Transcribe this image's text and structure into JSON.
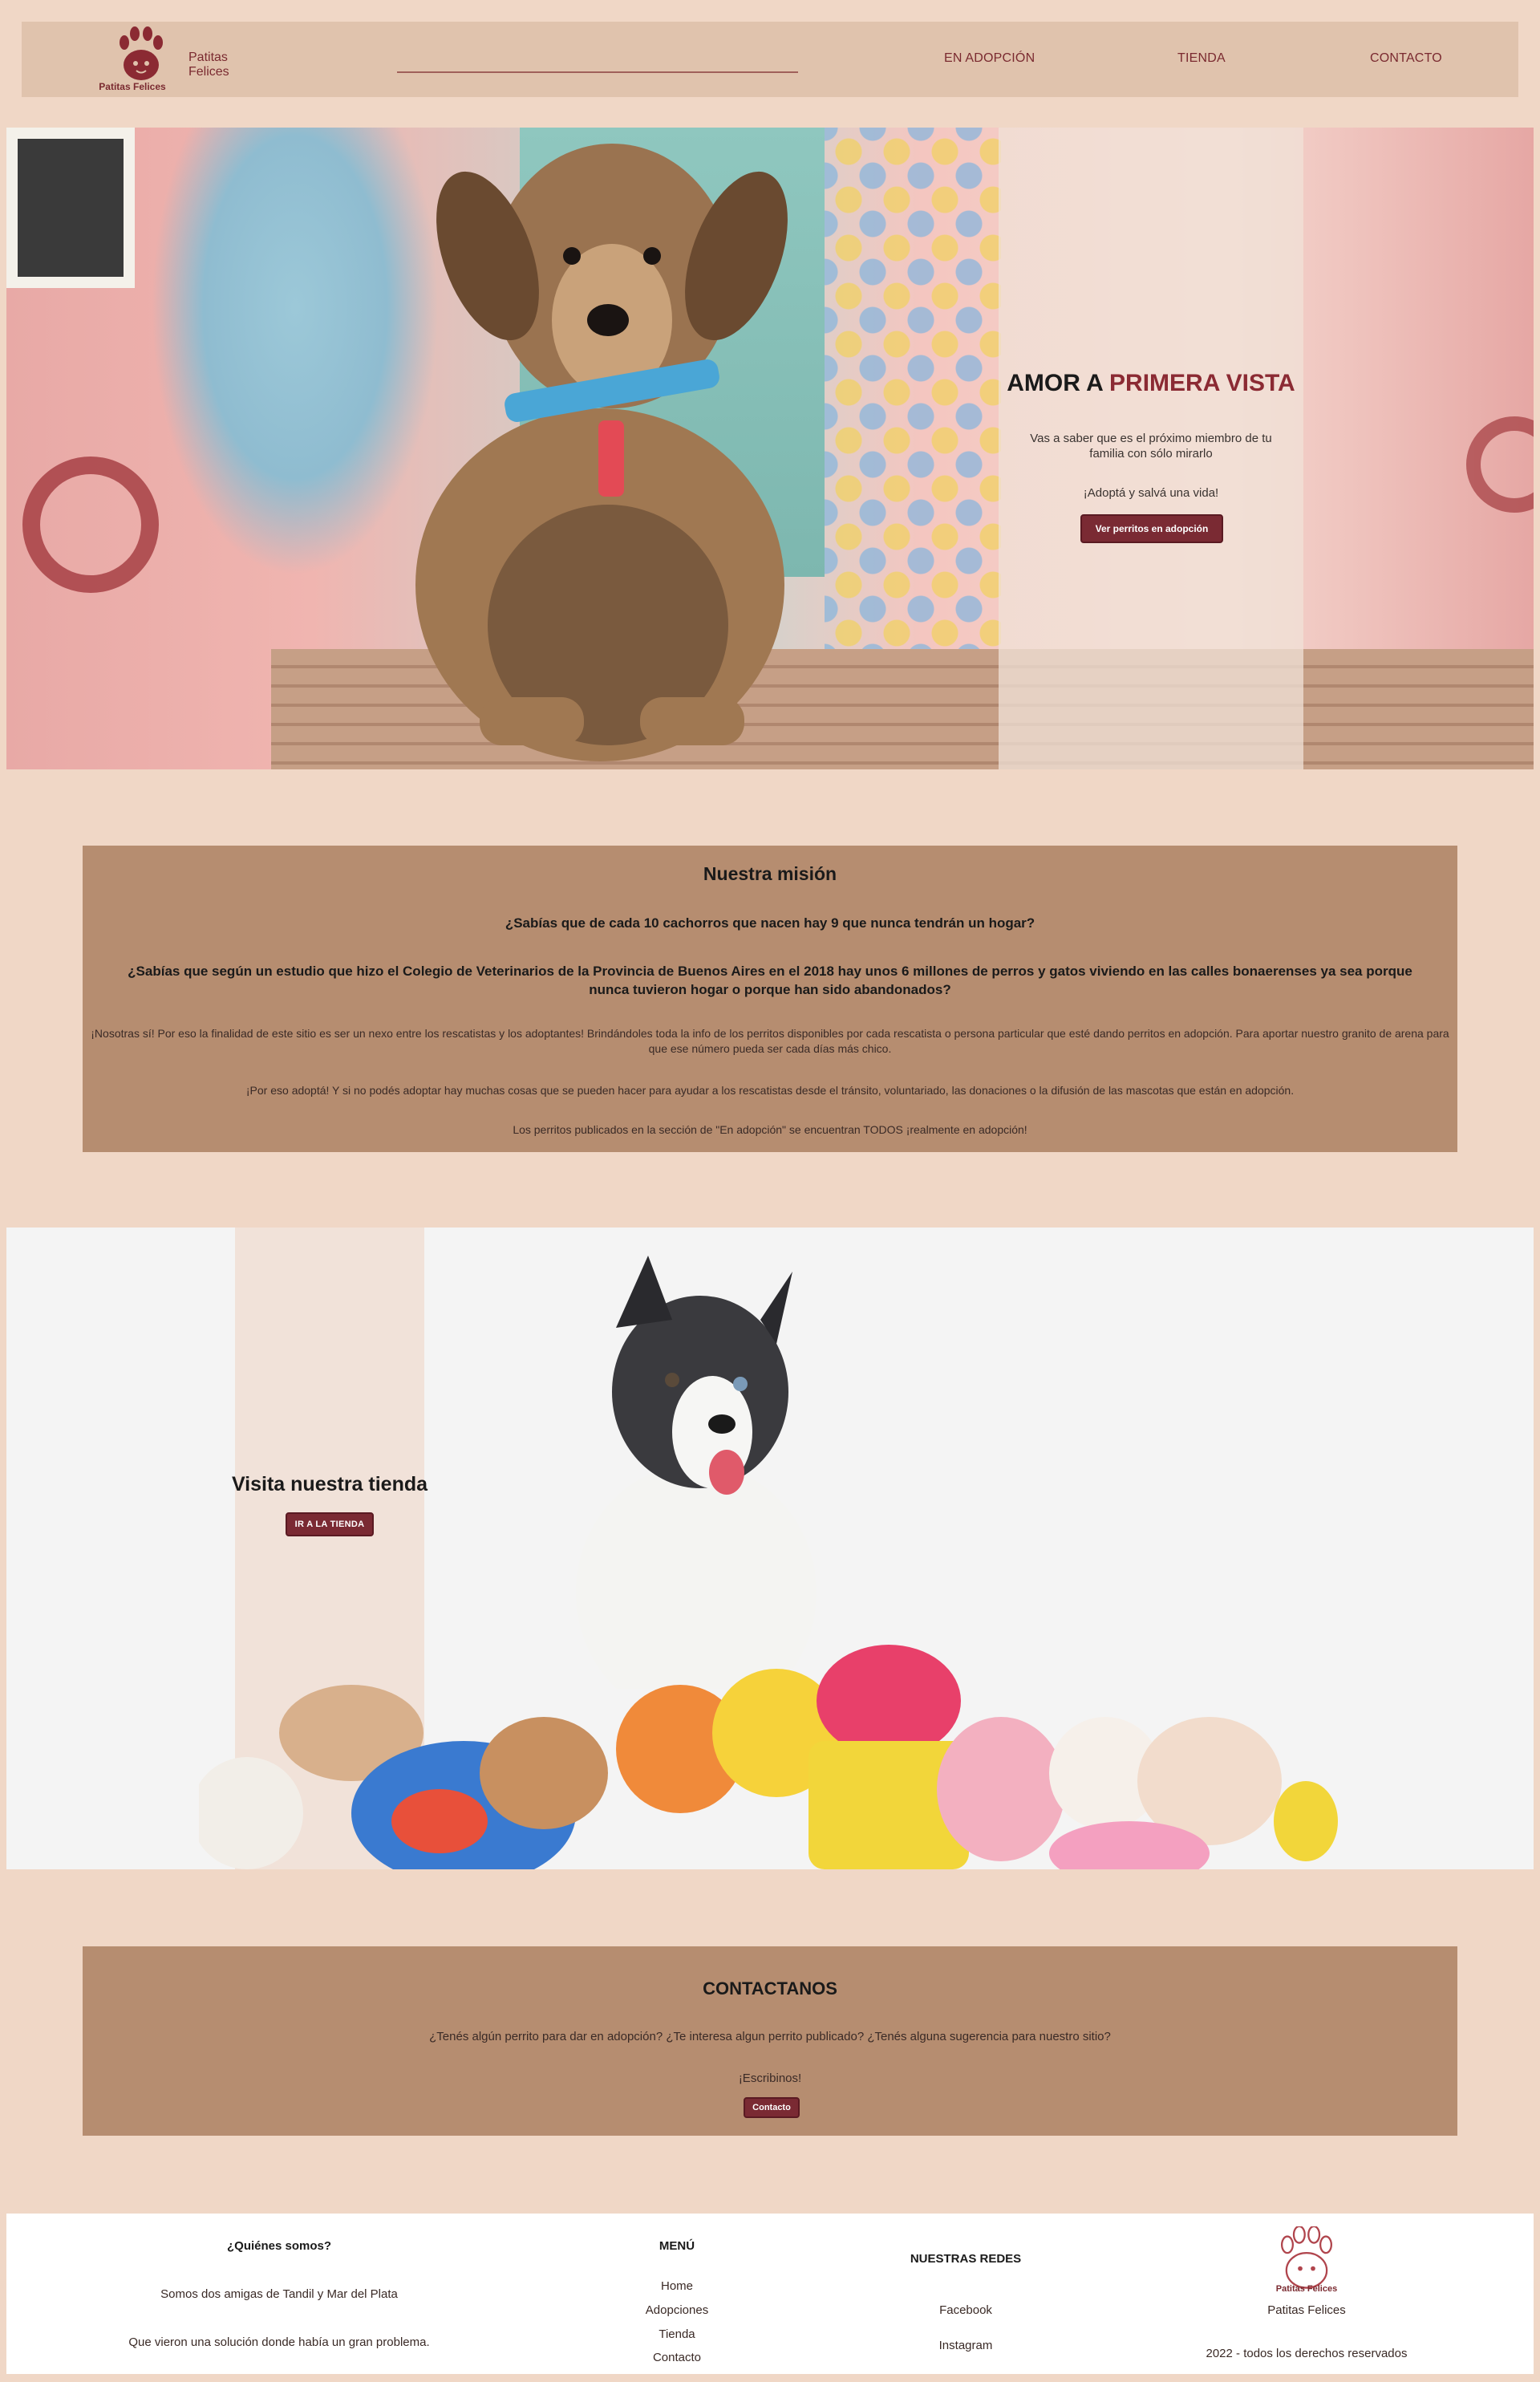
{
  "nav": {
    "brand_name": "Patitas Felices",
    "logo_caption": "Patitas Felices",
    "links": [
      "EN ADOPCIÓN",
      "TIENDA",
      "CONTACTO"
    ]
  },
  "hero": {
    "heading_plain": "AMOR A ",
    "heading_accent": "PRIMERA VISTA",
    "subtext": "Vas a saber que es el próximo miembro de tu familia con sólo mirarlo",
    "cta_text": "¡Adoptá y salvá una vida!",
    "button_label": "Ver perritos en adopción"
  },
  "mission": {
    "title": "Nuestra misión",
    "question_1": "¿Sabías que de cada 10 cachorros que nacen hay 9 que nunca tendrán un hogar?",
    "question_2": "¿Sabías que según un estudio que hizo el Colegio de Veterinarios de la Provincia de Buenos Aires en el 2018 hay unos 6 millones de perros y gatos viviendo en las calles bonaerenses ya sea porque nunca tuvieron hogar o porque han sido abandonados?",
    "paragraph_1": "¡Nosotras sí! Por eso la finalidad de este sitio es ser un nexo entre los rescatistas y los adoptantes! Brindándoles toda la info de los perritos disponibles por cada rescatista o persona particular que esté dando perritos en adopción. Para aportar nuestro granito de arena para que ese número pueda ser cada días más chico.",
    "paragraph_2": "¡Por eso adoptá! Y si no podés adoptar hay muchas cosas que se pueden hacer para ayudar a los rescatistas desde el tránsito, voluntariado, las donaciones o la difusión de las mascotas que están en adopción.",
    "paragraph_3": "Los perritos publicados en la sección de \"En adopción\" se encuentran TODOS ¡realmente en adopción!"
  },
  "store": {
    "title": "Visita nuestra tienda",
    "button_label": "IR A LA TIENDA"
  },
  "contact": {
    "title": "CONTACTANOS",
    "question": "¿Tenés algún perrito para dar en adopción? ¿Te interesa algun perrito publicado? ¿Tenés alguna sugerencia para nuestro sitio?",
    "write_us": "¡Escribinos!",
    "button_label": "Contacto"
  },
  "footer": {
    "about_title": "¿Quiénes somos?",
    "about_line_1": "Somos dos amigas de Tandil y Mar del Plata",
    "about_line_2": "Que vieron una solución donde había un gran problema.",
    "menu_title": "MENÚ",
    "menu_items": [
      "Home",
      "Adopciones",
      "Tienda",
      "Contacto"
    ],
    "social_title": "NUESTRAS REDES",
    "social_items": [
      "Facebook",
      "Instagram"
    ],
    "logo_caption": "Patitas Felices",
    "brand_name": "Patitas Felices",
    "copyright": "2022 - todos los derechos reservados"
  },
  "colors": {
    "page_bg": "#f0d7c6",
    "navbar_bg": "#e0c3ad",
    "section_bg": "#b68d70",
    "accent": "#7a2a33"
  }
}
